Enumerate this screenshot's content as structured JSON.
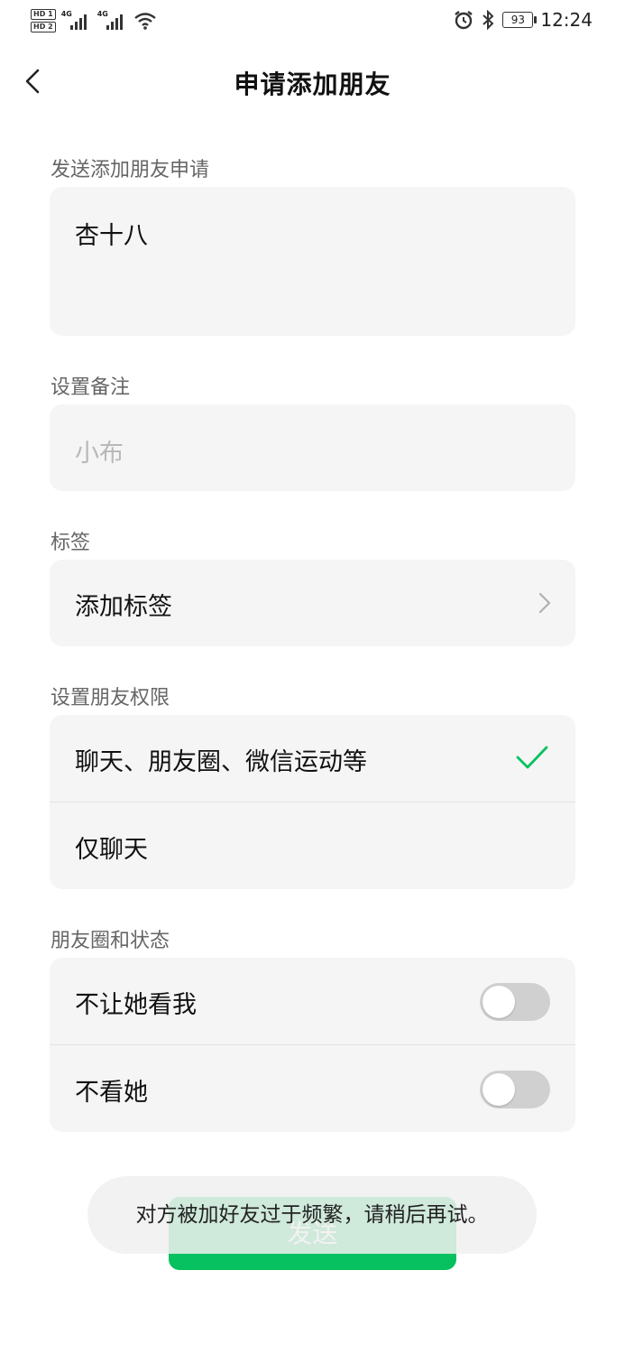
{
  "status_bar": {
    "hd1": "HD 1",
    "hd2": "HD 2",
    "net1": "4G",
    "net2": "4G",
    "battery": "93",
    "time": "12:24",
    "icons": [
      "wifi-icon",
      "alarm-icon",
      "bluetooth-icon",
      "battery-icon"
    ]
  },
  "nav": {
    "title": "申请添加朋友",
    "back_icon": "chevron-left-icon"
  },
  "request": {
    "label": "发送添加朋友申请",
    "value": "杏十八"
  },
  "remark": {
    "label": "设置备注",
    "placeholder": "小布"
  },
  "tags": {
    "label": "标签",
    "item": "添加标签"
  },
  "permissions": {
    "label": "设置朋友权限",
    "options": [
      {
        "label": "聊天、朋友圈、微信运动等",
        "selected": true
      },
      {
        "label": "仅聊天",
        "selected": false
      }
    ]
  },
  "moments": {
    "label": "朋友圈和状态",
    "items": [
      {
        "label": "不让她看我",
        "on": false
      },
      {
        "label": "不看她",
        "on": false
      }
    ]
  },
  "send_button": "发送",
  "toast": "对方被加好友过于频繁，请稍后再试。",
  "colors": {
    "accent": "#07c160",
    "card": "#f5f5f5",
    "label": "#666666"
  }
}
